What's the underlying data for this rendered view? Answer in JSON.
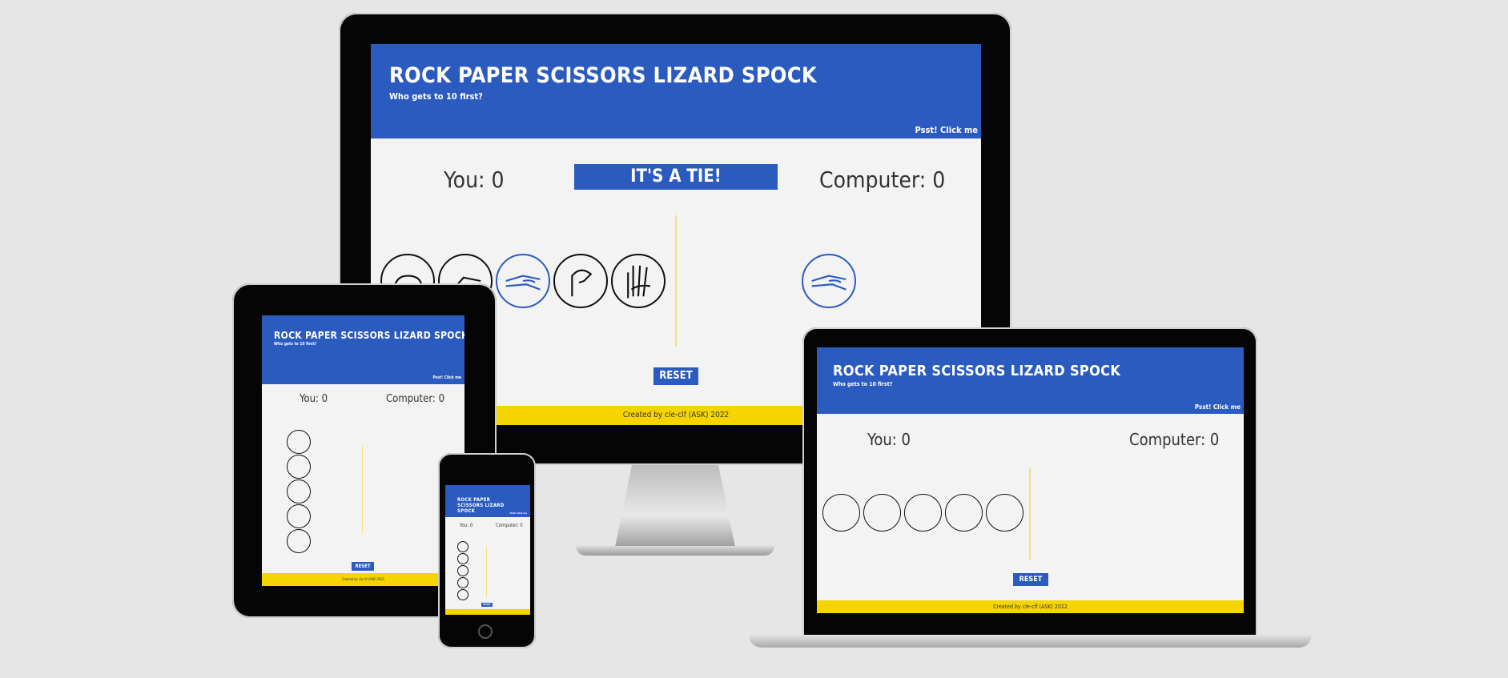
{
  "app": {
    "title": "ROCK PAPER SCISSORS LIZARD SPOCK",
    "subtitle": "Who gets to 10 first?",
    "past_link": "Psst! Click me",
    "you_score": "You: 0",
    "computer_score": "Computer: 0",
    "result": "IT'S A TIE!",
    "reset": "RESET",
    "footer": "Created by cle-clf (ASK) 2022"
  },
  "choices": [
    "rock-icon",
    "paper-icon",
    "scissors-icon",
    "lizard-icon",
    "spock-icon"
  ],
  "colors": {
    "header_blue": "#2b5bbe",
    "footer_yellow": "#f5d400",
    "background": "#f3f3f4"
  }
}
